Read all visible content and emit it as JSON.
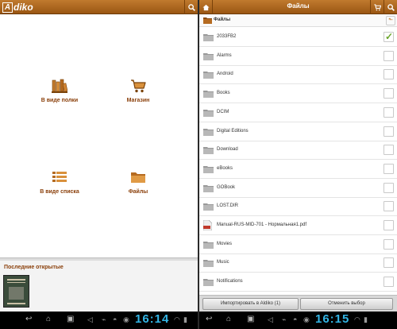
{
  "left": {
    "logo": {
      "letter": "A",
      "text": "diko"
    },
    "grid": [
      {
        "label": "В виде полки",
        "icon": "bookshelf-icon"
      },
      {
        "label": "Магазин",
        "icon": "cart-icon"
      },
      {
        "label": "В виде списка",
        "icon": "list-icon"
      },
      {
        "label": "Файлы",
        "icon": "folder-icon"
      }
    ],
    "recent_title": "Последние открытые",
    "status_time": "16:14"
  },
  "right": {
    "title": "Файлы",
    "breadcrumb": "Файлы",
    "files": [
      {
        "name": "2033FB2",
        "type": "folder",
        "checked": true
      },
      {
        "name": "Alarms",
        "type": "folder",
        "checked": false
      },
      {
        "name": "Android",
        "type": "folder",
        "checked": false
      },
      {
        "name": "Books",
        "type": "folder",
        "checked": false
      },
      {
        "name": "DCIM",
        "type": "folder",
        "checked": false
      },
      {
        "name": "Digital Editions",
        "type": "folder",
        "checked": false
      },
      {
        "name": "Download",
        "type": "folder",
        "checked": false
      },
      {
        "name": "eBooks",
        "type": "folder",
        "checked": false
      },
      {
        "name": "GOBook",
        "type": "folder",
        "checked": false
      },
      {
        "name": "LOST.DIR",
        "type": "folder",
        "checked": false
      },
      {
        "name": "Manual-RUS-MID-701 - Нормальная1.pdf",
        "type": "pdf",
        "checked": false
      },
      {
        "name": "Movies",
        "type": "folder",
        "checked": false
      },
      {
        "name": "Music",
        "type": "folder",
        "checked": false
      },
      {
        "name": "Notifications",
        "type": "folder",
        "checked": false
      }
    ],
    "import_button": "Импортировать в Aldiko (1)",
    "cancel_button": "Отменить выбор",
    "status_time": "16:15"
  },
  "colors": {
    "brand": "#a9621d",
    "label": "#8a3f0a",
    "clock": "#33b5e5",
    "check": "#6aa52a"
  }
}
